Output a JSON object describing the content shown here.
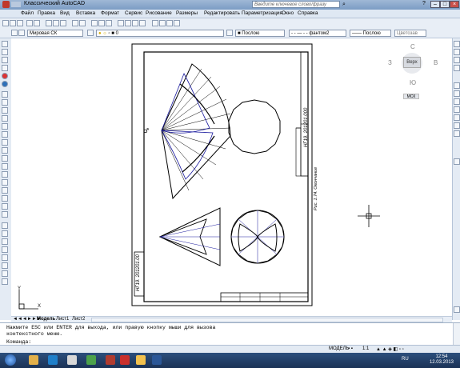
{
  "window": {
    "title": "Классический AutoCAD",
    "search_placeholder": "Введите ключевое слово/фразу"
  },
  "menu": [
    "Файл",
    "Правка",
    "Вид",
    "Вставка",
    "Формат",
    "Сервис",
    "Рисование",
    "Размеры",
    "Редактировать",
    "Параметризация",
    "Окно",
    "Справка"
  ],
  "toolbar": {
    "ucs": "Мировая СК",
    "layer": "0",
    "color": "Послою",
    "linetype": "фантом2",
    "lineweight": "Послою",
    "plotstyle": "Цветозав"
  },
  "drawing": {
    "code_top": "НГ19. 201201.000",
    "code_bottom": "НГ19. 201201.00",
    "caption": "Рис. 1.74. Окончание"
  },
  "viewcube": {
    "top_label": "Верх",
    "north": "С",
    "south": "Ю",
    "west": "З",
    "east": "В",
    "wcs": "МСК"
  },
  "tabs": [
    "Модель",
    "Лист1",
    "Лист2"
  ],
  "command": {
    "line1": "Нажмите ESC или ENTER для выхода, или правую кнопку мыши для вызова",
    "line2": "контекстного меню.",
    "prompt": "Команда:"
  },
  "status": {
    "model": "МОДЕЛЬ",
    "scale": "1:1"
  },
  "taskbar": {
    "lang": "RU",
    "time": "12:54",
    "date": "12.03.2013"
  }
}
